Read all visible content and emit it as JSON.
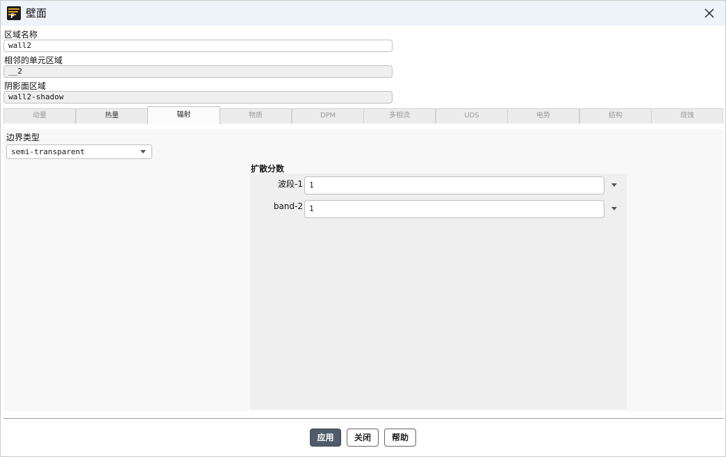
{
  "window": {
    "title": "壁面",
    "app_icon": "fluent-app-icon",
    "app_icon_letter": "F",
    "close_icon": "close-icon"
  },
  "fields": {
    "zone_name": {
      "label": "区域名称",
      "value": "wall2"
    },
    "adjacent_cell_zone": {
      "label": "相邻的单元区域",
      "value": "__2"
    },
    "shadow_face_zone": {
      "label": "阴影面区域",
      "value": "wall2-shadow"
    }
  },
  "tabs": [
    {
      "label": "动量",
      "active": false
    },
    {
      "label": "热量",
      "active": false
    },
    {
      "label": "辐射",
      "active": true
    },
    {
      "label": "物质",
      "active": false
    },
    {
      "label": "DPM",
      "active": false
    },
    {
      "label": "多相流",
      "active": false
    },
    {
      "label": "UDS",
      "active": false
    },
    {
      "label": "电势",
      "active": false
    },
    {
      "label": "结构",
      "active": false
    },
    {
      "label": "烧蚀",
      "active": false
    }
  ],
  "radiation": {
    "boundary_type_label": "边界类型",
    "boundary_type_value": "semi-transparent",
    "diffuse_fraction": {
      "title": "扩散分数",
      "bands": [
        {
          "label": "波段-1",
          "value": "1"
        },
        {
          "label": "band-2",
          "value": "1"
        }
      ]
    }
  },
  "buttons": {
    "apply": "应用",
    "close": "关闭",
    "help": "帮助"
  },
  "colors": {
    "titlebar": "#eef2f9",
    "primary_button": "#4f5b69",
    "icon_accent": "#e39a1f"
  }
}
